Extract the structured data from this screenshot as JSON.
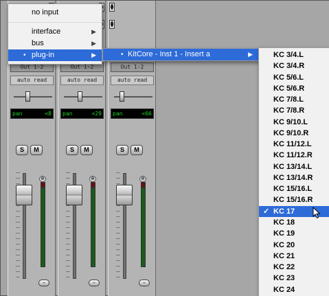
{
  "strips": [
    {
      "output": "Out 1-2",
      "automation": "auto read",
      "pan_label": "pan",
      "pan_value": "<8",
      "solo": "S",
      "mute": "M"
    },
    {
      "output": "Out 1-2",
      "automation": "auto read",
      "pan_label": "pan",
      "pan_value": "<29",
      "solo": "S",
      "mute": "M"
    },
    {
      "output": "Out 1-2",
      "automation": "auto read",
      "pan_label": "pan",
      "pan_value": "<66",
      "solo": "S",
      "mute": "M"
    }
  ],
  "menu1": {
    "items": [
      {
        "label": "no input"
      },
      {
        "label": "interface"
      },
      {
        "label": "bus"
      },
      {
        "label": "plug-in"
      }
    ]
  },
  "menu2": {
    "items": [
      {
        "label": "KitCore - Inst 1 - Insert a"
      }
    ]
  },
  "menu3": {
    "items": [
      "KC 3/4.L",
      "KC 3/4.R",
      "KC 5/6.L",
      "KC 5/6.R",
      "KC 7/8.L",
      "KC 7/8.R",
      "KC 9/10.L",
      "KC 9/10.R",
      "KC 11/12.L",
      "KC 11/12.R",
      "KC 13/14.L",
      "KC 13/14.R",
      "KC 15/16.L",
      "KC 15/16.R",
      "KC 17",
      "KC 18",
      "KC 19",
      "KC 20",
      "KC 21",
      "KC 22",
      "KC 23",
      "KC 24"
    ],
    "selected": "KC 17"
  },
  "colors": {
    "menu_highlight": "#2d6bd8",
    "pan_text": "#22d22a"
  }
}
